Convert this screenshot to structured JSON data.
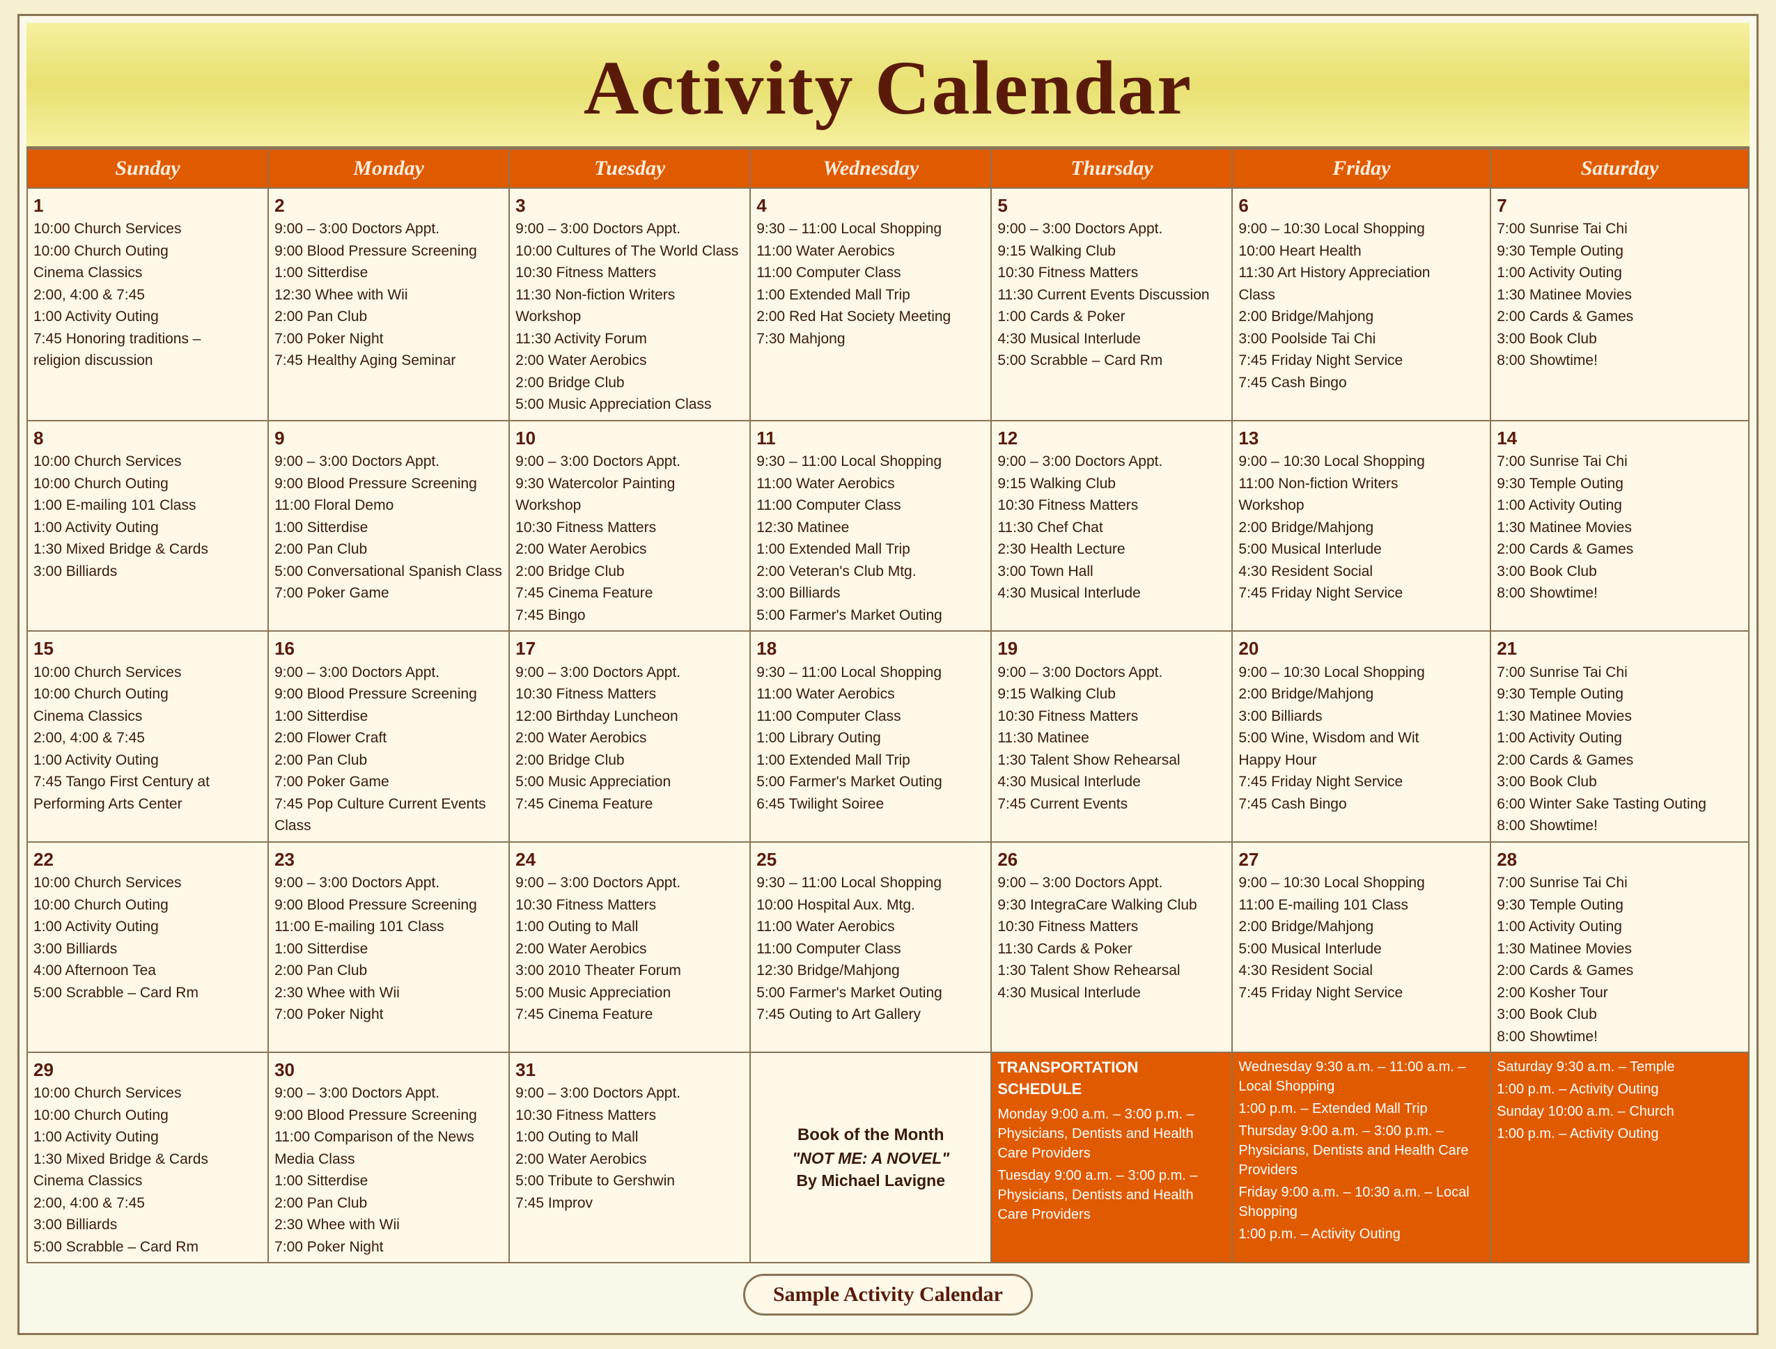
{
  "title": "Activity Calendar",
  "days_of_week": [
    "Sunday",
    "Monday",
    "Tuesday",
    "Wednesday",
    "Thursday",
    "Friday",
    "Saturday"
  ],
  "footer": "Sample Activity Calendar",
  "weeks": [
    {
      "cells": [
        {
          "day": 1,
          "events": [
            "10:00 Church Services",
            "10:00 Church Outing",
            "Cinema Classics",
            "2:00, 4:00 & 7:45",
            "1:00 Activity Outing",
            "7:45 Honoring traditions –",
            "religion discussion"
          ]
        },
        {
          "day": 2,
          "events": [
            "9:00 – 3:00 Doctors Appt.",
            "9:00 Blood Pressure Screening",
            "1:00 Sitterdise",
            "12:30 Whee with Wii",
            "2:00 Pan Club",
            "7:00 Poker Night",
            "7:45 Healthy Aging Seminar"
          ]
        },
        {
          "day": 3,
          "events": [
            "9:00 – 3:00 Doctors Appt.",
            "10:00 Cultures of The World Class",
            "10:30 Fitness Matters",
            "11:30 Non-fiction Writers Workshop",
            "11:30 Activity Forum",
            "2:00 Water Aerobics",
            "2:00 Bridge Club",
            "5:00 Music Appreciation Class"
          ]
        },
        {
          "day": 4,
          "events": [
            "9:30 – 11:00 Local Shopping",
            "11:00 Water Aerobics",
            "11:00 Computer Class",
            "1:00 Extended Mall Trip",
            "2:00 Red Hat Society Meeting",
            "7:30 Mahjong"
          ]
        },
        {
          "day": 5,
          "events": [
            "9:00 – 3:00 Doctors Appt.",
            "9:15 Walking Club",
            "10:30 Fitness Matters",
            "11:30 Current Events Discussion",
            "1:00 Cards & Poker",
            "4:30 Musical Interlude",
            "5:00 Scrabble – Card Rm"
          ]
        },
        {
          "day": 6,
          "events": [
            "9:00 – 10:30 Local Shopping",
            "10:00 Heart Health",
            "11:30 Art History Appreciation",
            "Class",
            "2:00 Bridge/Mahjong",
            "3:00 Poolside Tai Chi",
            "7:45 Friday Night Service",
            "7:45 Cash Bingo"
          ]
        },
        {
          "day": 7,
          "events": [
            "7:00 Sunrise Tai Chi",
            "9:30 Temple Outing",
            "1:00 Activity Outing",
            "1:30 Matinee Movies",
            "2:00 Cards & Games",
            "3:00 Book Club",
            "8:00 Showtime!"
          ]
        }
      ]
    },
    {
      "cells": [
        {
          "day": 8,
          "events": [
            "10:00 Church Services",
            "10:00 Church Outing",
            "1:00 E-mailing 101 Class",
            "1:00 Activity Outing",
            "1:30 Mixed Bridge & Cards",
            "3:00 Billiards"
          ]
        },
        {
          "day": 9,
          "events": [
            "9:00 – 3:00 Doctors Appt.",
            "9:00 Blood Pressure Screening",
            "11:00 Floral Demo",
            "1:00 Sitterdise",
            "2:00 Pan Club",
            "5:00 Conversational Spanish Class",
            "7:00 Poker Game"
          ]
        },
        {
          "day": 10,
          "events": [
            "9:00 – 3:00 Doctors Appt.",
            "9:30 Watercolor Painting",
            "Workshop",
            "10:30 Fitness Matters",
            "2:00 Water Aerobics",
            "2:00 Bridge Club",
            "7:45 Cinema Feature",
            "7:45 Bingo"
          ]
        },
        {
          "day": 11,
          "events": [
            "9:30 – 11:00 Local Shopping",
            "11:00 Water Aerobics",
            "11:00 Computer Class",
            "12:30 Matinee",
            "1:00 Extended Mall Trip",
            "2:00 Veteran's Club Mtg.",
            "3:00 Billiards",
            "5:00 Farmer's Market Outing"
          ]
        },
        {
          "day": 12,
          "events": [
            "9:00 – 3:00 Doctors Appt.",
            "9:15 Walking Club",
            "10:30 Fitness Matters",
            "11:30 Chef Chat",
            "2:30 Health Lecture",
            "3:00 Town Hall",
            "4:30 Musical Interlude"
          ]
        },
        {
          "day": 13,
          "events": [
            "9:00 – 10:30 Local Shopping",
            "11:00 Non-fiction Writers",
            "Workshop",
            "2:00 Bridge/Mahjong",
            "5:00 Musical Interlude",
            "4:30 Resident Social",
            "7:45 Friday Night Service"
          ]
        },
        {
          "day": 14,
          "events": [
            "7:00 Sunrise Tai Chi",
            "9:30 Temple Outing",
            "1:00 Activity Outing",
            "1:30 Matinee Movies",
            "2:00 Cards & Games",
            "3:00 Book Club",
            "8:00 Showtime!"
          ]
        }
      ]
    },
    {
      "cells": [
        {
          "day": 15,
          "events": [
            "10:00 Church Services",
            "10:00 Church Outing",
            "Cinema Classics",
            "2:00, 4:00 & 7:45",
            "1:00 Activity Outing",
            "7:45 Tango First Century at",
            "Performing Arts Center"
          ]
        },
        {
          "day": 16,
          "events": [
            "9:00 – 3:00 Doctors Appt.",
            "9:00 Blood Pressure Screening",
            "1:00 Sitterdise",
            "2:00 Flower Craft",
            "2:00 Pan Club",
            "7:00 Poker Game",
            "7:45 Pop Culture Current Events",
            "Class"
          ]
        },
        {
          "day": 17,
          "events": [
            "9:00 – 3:00 Doctors Appt.",
            "10:30 Fitness Matters",
            "12:00 Birthday Luncheon",
            "2:00 Water Aerobics",
            "2:00 Bridge Club",
            "5:00 Music Appreciation",
            "7:45 Cinema Feature"
          ]
        },
        {
          "day": 18,
          "events": [
            "9:30 – 11:00 Local Shopping",
            "11:00 Water Aerobics",
            "11:00 Computer Class",
            "1:00 Library Outing",
            "1:00 Extended Mall Trip",
            "5:00 Farmer's Market Outing",
            "6:45 Twilight Soiree"
          ]
        },
        {
          "day": 19,
          "events": [
            "9:00 – 3:00 Doctors Appt.",
            "9:15 Walking Club",
            "10:30 Fitness Matters",
            "11:30 Matinee",
            "1:30 Talent Show Rehearsal",
            "4:30 Musical Interlude",
            "7:45 Current Events"
          ]
        },
        {
          "day": 20,
          "events": [
            "9:00 – 10:30 Local Shopping",
            "2:00 Bridge/Mahjong",
            "3:00 Billiards",
            "5:00 Wine, Wisdom and Wit",
            "Happy Hour",
            "7:45 Friday Night Service",
            "7:45 Cash Bingo"
          ]
        },
        {
          "day": 21,
          "events": [
            "7:00 Sunrise Tai Chi",
            "9:30 Temple Outing",
            "1:30 Matinee Movies",
            "1:00 Activity Outing",
            "2:00 Cards & Games",
            "3:00 Book Club",
            "6:00 Winter Sake Tasting Outing",
            "8:00 Showtime!"
          ]
        }
      ]
    },
    {
      "cells": [
        {
          "day": 22,
          "events": [
            "10:00 Church Services",
            "10:00 Church Outing",
            "1:00 Activity Outing",
            "3:00 Billiards",
            "4:00 Afternoon Tea",
            "5:00 Scrabble – Card Rm"
          ]
        },
        {
          "day": 23,
          "events": [
            "9:00 – 3:00 Doctors Appt.",
            "9:00 Blood Pressure Screening",
            "11:00 E-mailing 101 Class",
            "1:00 Sitterdise",
            "2:00 Pan Club",
            "2:30 Whee with Wii",
            "7:00 Poker Night"
          ]
        },
        {
          "day": 24,
          "events": [
            "9:00 – 3:00 Doctors Appt.",
            "10:30 Fitness Matters",
            "1:00 Outing to Mall",
            "2:00 Water Aerobics",
            "3:00 2010 Theater Forum",
            "5:00 Music Appreciation",
            "7:45 Cinema Feature"
          ]
        },
        {
          "day": 25,
          "events": [
            "9:30 – 11:00 Local Shopping",
            "10:00 Hospital Aux. Mtg.",
            "11:00 Water Aerobics",
            "11:00 Computer Class",
            "12:30 Bridge/Mahjong",
            "5:00 Farmer's Market Outing",
            "7:45 Outing to Art Gallery"
          ]
        },
        {
          "day": 26,
          "events": [
            "9:00 – 3:00 Doctors Appt.",
            "9:30 IntegraCare Walking Club",
            "10:30 Fitness Matters",
            "11:30 Cards & Poker",
            "1:30 Talent Show Rehearsal",
            "4:30 Musical Interlude"
          ]
        },
        {
          "day": 27,
          "events": [
            "9:00 – 10:30 Local Shopping",
            "11:00 E-mailing 101 Class",
            "2:00 Bridge/Mahjong",
            "5:00 Musical Interlude",
            "4:30 Resident Social",
            "7:45 Friday Night Service"
          ]
        },
        {
          "day": 28,
          "events": [
            "7:00 Sunrise Tai Chi",
            "9:30 Temple Outing",
            "1:00 Activity Outing",
            "1:30 Matinee Movies",
            "2:00 Cards & Games",
            "2:00 Kosher Tour",
            "3:00 Book Club",
            "8:00 Showtime!"
          ]
        }
      ]
    },
    {
      "cells": [
        {
          "day": 29,
          "events": [
            "10:00 Church Services",
            "10:00 Church Outing",
            "1:00 Activity Outing",
            "1:30 Mixed Bridge & Cards",
            "Cinema Classics",
            "2:00, 4:00 & 7:45",
            "3:00 Billiards",
            "5:00 Scrabble – Card Rm"
          ]
        },
        {
          "day": 30,
          "events": [
            "9:00 – 3:00 Doctors Appt.",
            "9:00 Blood Pressure Screening",
            "11:00 Comparison of the News",
            "Media Class",
            "1:00 Sitterdise",
            "2:00 Pan Club",
            "2:30 Whee with Wii",
            "7:00 Poker Night"
          ]
        },
        {
          "day": 31,
          "events": [
            "9:00 – 3:00 Doctors Appt.",
            "10:30 Fitness Matters",
            "1:00 Outing to Mall",
            "2:00 Water Aerobics",
            "5:00 Tribute to Gershwin",
            "7:45 Improv"
          ]
        },
        {
          "day": null,
          "book": true,
          "book_lines": [
            "Book of the Month",
            "\"NOT ME: A NOVEL\"",
            "By Michael Lavigne"
          ]
        },
        {
          "day": null,
          "transport_mon_thu": true
        },
        {
          "day": null,
          "transport_wed_fri": true
        },
        {
          "day": null,
          "transport_sat_sun": true
        }
      ]
    }
  ],
  "transport": {
    "header": "TRANSPORTATION SCHEDULE",
    "monday": "Monday 9:00 a.m. – 3:00 p.m. – Physicians, Dentists and Health Care Providers",
    "tuesday": "Tuesday 9:00 a.m. – 3:00 p.m. – Physicians, Dentists and Health Care Providers",
    "wednesday": "Wednesday 9:30 a.m. – 11:00 a.m. – Local Shopping",
    "wednesday2": "1:00 p.m. – Extended Mall Trip",
    "thursday": "Thursday 9:00 a.m. – 3:00 p.m. – Physicians, Dentists and Health Care Providers",
    "friday": "Friday 9:00 a.m. – 10:30 a.m. – Local Shopping",
    "friday2": "1:00 p.m. – Activity Outing",
    "saturday": "Saturday 9:30 a.m. – Temple",
    "saturday2": "1:00 p.m. – Activity Outing",
    "sunday": "Sunday 10:00 a.m. – Church",
    "sunday2": "1:00 p.m. – Activity Outing"
  }
}
